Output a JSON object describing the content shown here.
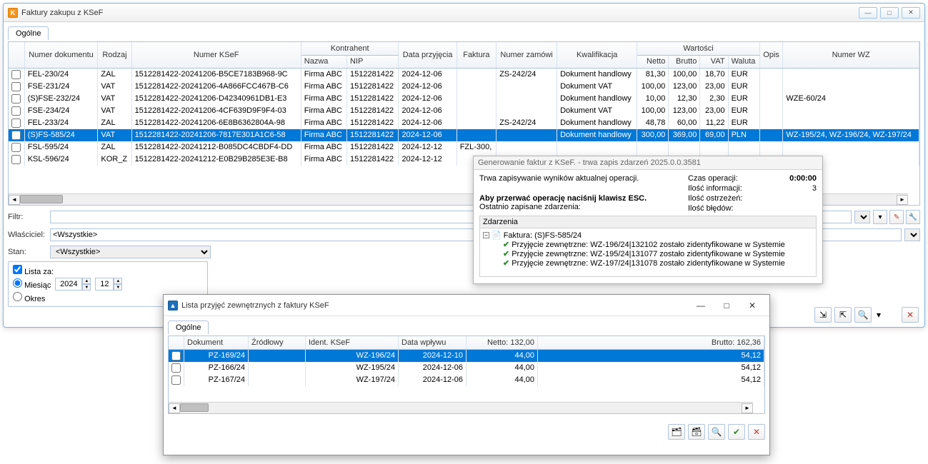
{
  "main": {
    "title": "Faktury zakupu z KSeF",
    "tab": "Ogólne",
    "columns": {
      "group_kontrahent": "Kontrahent",
      "group_wartosci": "Wartości",
      "chk": "",
      "numer_dok": "Numer dokumentu",
      "rodzaj": "Rodzaj",
      "numer_ksef": "Numer KSeF",
      "nazwa": "Nazwa",
      "nip": "NIP",
      "data_przyjecia": "Data przyjęcia",
      "faktura": "Faktura",
      "numer_zamow": "Numer zamówi",
      "kwalifikacja": "Kwalifikacja",
      "netto": "Netto",
      "brutto": "Brutto",
      "vat": "VAT",
      "waluta": "Waluta",
      "opis": "Opis",
      "numer_wz": "Numer WZ"
    },
    "rows": [
      {
        "numer": "FEL-230/24",
        "rodzaj": "ZAL",
        "ksef": "1512281422-20241206-B5CE7183B968-9C",
        "nazwa": "Firma ABC",
        "nip": "1512281422",
        "data": "2024-12-06",
        "faktura": "",
        "zamow": "ZS-242/24",
        "kwal": "Dokument handlowy",
        "netto": "81,30",
        "brutto": "100,00",
        "vat": "18,70",
        "waluta": "EUR",
        "wz": "",
        "sel": false
      },
      {
        "numer": "FSE-231/24",
        "rodzaj": "VAT",
        "ksef": "1512281422-20241206-4A866FCC467B-C6",
        "nazwa": "Firma ABC",
        "nip": "1512281422",
        "data": "2024-12-06",
        "faktura": "",
        "zamow": "",
        "kwal": "Dokument VAT",
        "netto": "100,00",
        "brutto": "123,00",
        "vat": "23,00",
        "waluta": "EUR",
        "wz": "",
        "sel": false
      },
      {
        "numer": "(S)FSE-232/24",
        "rodzaj": "VAT",
        "ksef": "1512281422-20241206-D42340961DB1-E3",
        "nazwa": "Firma ABC",
        "nip": "1512281422",
        "data": "2024-12-06",
        "faktura": "",
        "zamow": "",
        "kwal": "Dokument handlowy",
        "netto": "10,00",
        "brutto": "12,30",
        "vat": "2,30",
        "waluta": "EUR",
        "wz": "WZE-60/24",
        "sel": false
      },
      {
        "numer": "FSE-234/24",
        "rodzaj": "VAT",
        "ksef": "1512281422-20241206-4CF639D9F9F4-03",
        "nazwa": "Firma ABC",
        "nip": "1512281422",
        "data": "2024-12-06",
        "faktura": "",
        "zamow": "",
        "kwal": "Dokument VAT",
        "netto": "100,00",
        "brutto": "123,00",
        "vat": "23,00",
        "waluta": "EUR",
        "wz": "",
        "sel": false
      },
      {
        "numer": "FEL-233/24",
        "rodzaj": "ZAL",
        "ksef": "1512281422-20241206-6E8B6362804A-98",
        "nazwa": "Firma ABC",
        "nip": "1512281422",
        "data": "2024-12-06",
        "faktura": "",
        "zamow": "ZS-242/24",
        "kwal": "Dokument handlowy",
        "netto": "48,78",
        "brutto": "60,00",
        "vat": "11,22",
        "waluta": "EUR",
        "wz": "",
        "sel": false
      },
      {
        "numer": "(S)FS-585/24",
        "rodzaj": "VAT",
        "ksef": "1512281422-20241206-7817E301A1C6-58",
        "nazwa": "Firma ABC",
        "nip": "1512281422",
        "data": "2024-12-06",
        "faktura": "",
        "zamow": "",
        "kwal": "Dokument handlowy",
        "netto": "300,00",
        "brutto": "369,00",
        "vat": "69,00",
        "waluta": "PLN",
        "wz": "WZ-195/24, WZ-196/24, WZ-197/24",
        "sel": true
      },
      {
        "numer": "FSL-595/24",
        "rodzaj": "ZAL",
        "ksef": "1512281422-20241212-B085DC4CBDF4-DD",
        "nazwa": "Firma ABC",
        "nip": "1512281422",
        "data": "2024-12-12",
        "faktura": "FZL-300,",
        "zamow": "",
        "kwal": "",
        "netto": "",
        "brutto": "",
        "vat": "",
        "waluta": "",
        "wz": "",
        "sel": false
      },
      {
        "numer": "KSL-596/24",
        "rodzaj": "KOR_Z",
        "ksef": "1512281422-20241212-E0B29B285E3E-B8",
        "nazwa": "Firma ABC",
        "nip": "1512281422",
        "data": "2024-12-12",
        "faktura": "",
        "zamow": "",
        "kwal": "",
        "netto": "",
        "brutto": "",
        "vat": "",
        "waluta": "",
        "wz": "",
        "sel": false
      }
    ],
    "filtr_label": "Filtr:",
    "wlasciciel_label": "Właściciel:",
    "wlasciciel_value": "<Wszystkie>",
    "stan_label": "Stan:",
    "stan_value": "<Wszystkie>",
    "lista_za_label": "Lista za:",
    "miesiac_label": "Miesiąc",
    "okres_label": "Okres",
    "rok": "2024",
    "miesiac": "12"
  },
  "progress": {
    "title": "Generowanie faktur z KSeF. - trwa zapis zdarzeń 2025.0.0.3581",
    "msg1": "Trwa zapisywanie wyników aktualnej operacji.",
    "msg2_bold": "Aby przerwać operację naciśnij klawisz ESC.",
    "last_events": "Ostatnio zapisane zdarzenia:",
    "stats": {
      "czas_label": "Czas operacji:",
      "czas": "0:00:00",
      "info_label": "Ilość informacji:",
      "info": "3",
      "ostrz_label": "Ilość ostrzeżeń:",
      "ostrz": "",
      "bled_label": "Ilość błędów:",
      "bled": ""
    },
    "events_header": "Zdarzenia",
    "root": "Faktura: (S)FS-585/24",
    "children": [
      "Przyjęcie zewnętrzne: WZ-196/24|132102 zostało zidentyfikowane w Systemie",
      "Przyjęcie zewnętrzne: WZ-195/24|131077 zostało zidentyfikowane w Systemie",
      "Przyjęcie zewnętrzne: WZ-197/24|131078 zostało zidentyfikowane w Systemie"
    ]
  },
  "sub": {
    "title": "Lista przyjęć zewnętrznych z faktury KSeF",
    "tab": "Ogólne",
    "columns": {
      "chk": "",
      "dokument": "Dokument",
      "zrodlowy": "Źródłowy",
      "ident": "Ident. KSeF",
      "data_wplywu": "Data wpływu",
      "netto": "Netto: 132,00",
      "brutto": "Brutto: 162,36"
    },
    "rows": [
      {
        "dok": "PZ-169/24",
        "zrod": "",
        "ident": "WZ-196/24",
        "data": "2024-12-10",
        "netto": "44,00",
        "brutto": "54,12",
        "sel": true
      },
      {
        "dok": "PZ-166/24",
        "zrod": "",
        "ident": "WZ-195/24",
        "data": "2024-12-06",
        "netto": "44,00",
        "brutto": "54,12",
        "sel": false
      },
      {
        "dok": "PZ-167/24",
        "zrod": "",
        "ident": "WZ-197/24",
        "data": "2024-12-06",
        "netto": "44,00",
        "brutto": "54,12",
        "sel": false
      }
    ]
  }
}
